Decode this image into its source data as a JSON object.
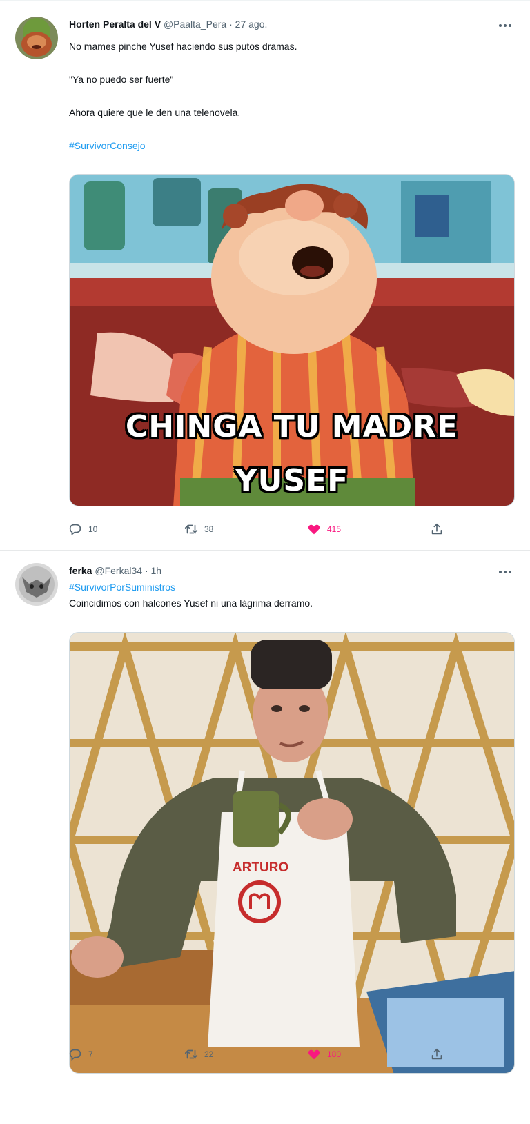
{
  "tweets": [
    {
      "author_name": "Horten Peralta del V",
      "author_handle": "@Paalta_Pera",
      "separator": "·",
      "time": "27 ago.",
      "text_lines": [
        "No mames pinche Yusef haciendo sus putos dramas.",
        "\"Ya no puedo ser fuerte\"",
        "Ahora quiere que le den una telenovela."
      ],
      "hashtag": "#SurvivorConsejo",
      "media": {
        "caption_line_1": "CHINGA TU MADRE",
        "caption_line_2": "YUSEF"
      },
      "stats": {
        "replies": "10",
        "retweets": "38",
        "likes": "415"
      }
    },
    {
      "author_name": "ferka",
      "author_handle": "@Ferkal34",
      "separator": "·",
      "time": "1h",
      "hashtag": "#SurvivorPorSuministros",
      "text_lines": [
        "Coincidimos con halcones Yusef ni una lágrima derramo."
      ],
      "media": {
        "apron_label": "ARTURO"
      },
      "stats": {
        "replies": "7",
        "retweets": "22",
        "likes": "180"
      }
    }
  ],
  "icons": {
    "reply": "reply-icon",
    "retweet": "retweet-icon",
    "like": "heart-icon",
    "share": "share-icon",
    "more": "more-icon"
  },
  "colors": {
    "hashtag": "#1d9bf0",
    "like_active": "#f91880",
    "muted": "#536471",
    "divider": "#eff3f4"
  }
}
